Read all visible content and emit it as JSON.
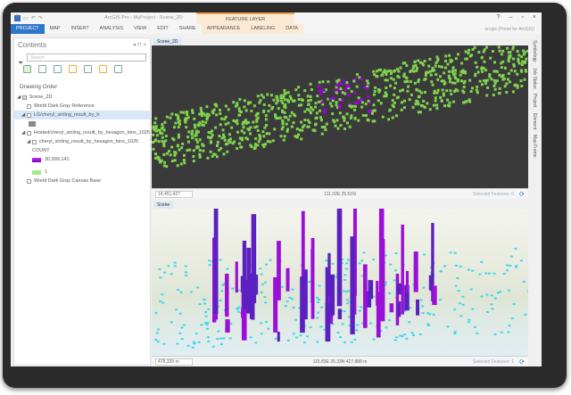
{
  "window": {
    "title": "ArcGIS Pro - MyProject - Scene_2D",
    "context_tab": "FEATURE LAYER",
    "user": "arcgis (Portal for ArcGIS)"
  },
  "ribbon": {
    "tabs": [
      "PROJECT",
      "MAP",
      "INSERT",
      "ANALYSIS",
      "VIEW",
      "EDIT",
      "SHARE",
      "APPEARANCE",
      "LABELING",
      "DATA"
    ]
  },
  "contents": {
    "title": "Contents",
    "search_placeholder": "Search",
    "heading": "Drawing Order",
    "items": [
      {
        "label": "Scene_2D",
        "checked": true
      },
      {
        "label": "World Dark Gray Reference",
        "checked": false
      },
      {
        "label": "LG/cheryl_sinling_result_by_h",
        "checked": false
      },
      {
        "label": "Hosted/cheryl_sinling_result_by_hexagon_bins_1025",
        "checked": true
      },
      {
        "label": "cheryl_sinling_result_by_hexagon_bins_1025",
        "checked": true
      }
    ],
    "legend_title": "COUNT",
    "legend_max": "30,999,141",
    "legend_min": "1",
    "base": "World Dark Gray Canvas Base"
  },
  "view2d": {
    "tab": "Scene_2D",
    "scale": "14,451,427",
    "coords": "111.32E 25.51N",
    "selected": "Selected Features: 0"
  },
  "view3d": {
    "tab": "Scene",
    "scale": "478,339 m",
    "coords": "115.83E 26.33N   427.888 m",
    "selected": "Selected Features: 1"
  },
  "side_tabs": [
    "Symbology",
    "Job Status",
    "Project",
    "Element",
    "Map Frame"
  ],
  "colors": {
    "accent": "#2e76c7",
    "high": "#a000e0",
    "low": "#7fd34e"
  }
}
